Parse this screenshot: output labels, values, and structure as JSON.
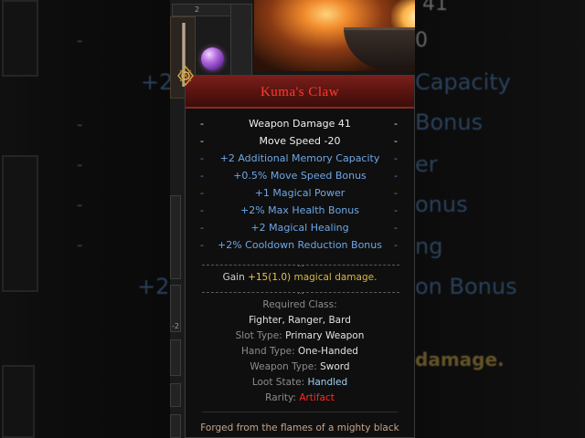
{
  "item": {
    "name": "Kuma's Claw",
    "stats": [
      {
        "text": "Weapon Damage 41",
        "kind": "base"
      },
      {
        "text": "Move Speed -20",
        "kind": "base"
      },
      {
        "text": "+2 Additional Memory Capacity",
        "kind": "bonus"
      },
      {
        "text": "+0.5% Move Speed Bonus",
        "kind": "bonus"
      },
      {
        "text": "+1 Magical Power",
        "kind": "bonus"
      },
      {
        "text": "+2% Max Health Bonus",
        "kind": "bonus"
      },
      {
        "text": "+2 Magical Healing",
        "kind": "bonus"
      },
      {
        "text": "+2% Cooldown Reduction Bonus",
        "kind": "bonus"
      }
    ],
    "effect": {
      "prefix": "Gain",
      "amount": "+15(1.0)",
      "suffix": "magical damage."
    },
    "required_class_label": "Required Class:",
    "required_class_value": "Fighter, Ranger, Bard",
    "slot_type_label": "Slot Type:",
    "slot_type_value": "Primary Weapon",
    "hand_type_label": "Hand Type:",
    "hand_type_value": "One-Handed",
    "weapon_type_label": "Weapon Type:",
    "weapon_type_value": "Sword",
    "loot_state_label": "Loot State:",
    "loot_state_value": "Handled",
    "rarity_label": "Rarity:",
    "rarity_value": "Artifact",
    "flavor_text": "Forged from the flames of a mighty black",
    "divider_marker": "...",
    "dash": "-"
  },
  "inventory": {
    "slot_number_top": "2",
    "slot_number_side": "-2"
  },
  "background": {
    "right_lines": [
      "41",
      "0",
      "Capacity",
      "Bonus",
      "er",
      "onus",
      "ng",
      "on Bonus",
      "damage."
    ],
    "left_lines": [
      "+2",
      "+2"
    ]
  },
  "colors": {
    "title_red": "#ff3b30",
    "stat_white": "#f0f0f0",
    "stat_blue": "#6ea7e6",
    "effect_gold": "#e8c548",
    "rarity_red": "#ff2a1f",
    "flavor_tan": "#c4a58a"
  },
  "icons": [
    "celtic-knot-corner-icon",
    "magic-orb-icon",
    "sword-icon"
  ]
}
